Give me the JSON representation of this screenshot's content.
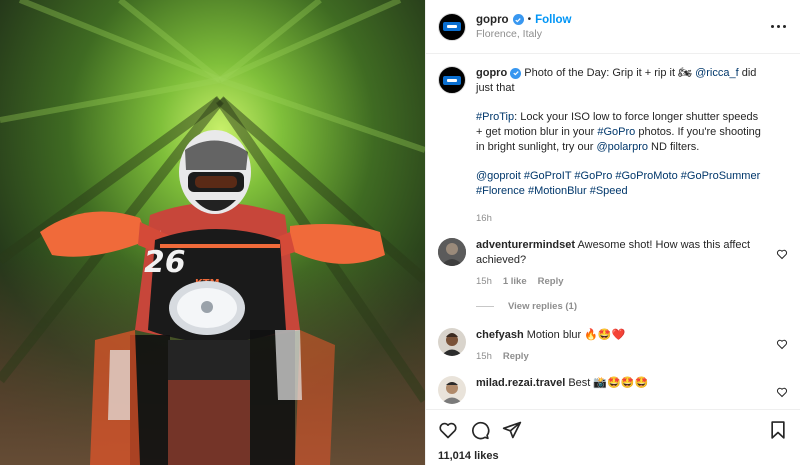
{
  "post": {
    "username": "gopro",
    "follow_label": "Follow",
    "separator": "•",
    "location": "Florence, Italy"
  },
  "caption": {
    "username": "gopro",
    "line1": "Photo of the Day: Grip it + rip it 🏍",
    "mention_ricca": "@ricca_f",
    "line1_end": " did just that",
    "protip_tag": "#ProTip",
    "protip_text_a": ": Lock your ISO low to force longer shutter speeds + get motion blur in your ",
    "gopro_tag": "#GoPro",
    "protip_text_b": " photos. If you're shooting in bright sunlight, try our ",
    "mention_polarpro": "@polarpro",
    "protip_text_c": " ND filters.",
    "hashtags": "@goproit #GoProIT #GoPro #GoProMoto #GoProSummer #Florence #MotionBlur #Speed",
    "time": "16h"
  },
  "comments": [
    {
      "username": "adventurermindset",
      "text": "Awesome shot! How was this affect achieved?",
      "time": "15h",
      "likes": "1 like",
      "reply_label": "Reply",
      "view_replies": "View replies (1)"
    },
    {
      "username": "chefyash",
      "text": "Motion blur 🔥🤩❤️",
      "time": "15h",
      "reply_label": "Reply"
    },
    {
      "username": "milad.rezai.travel",
      "text": "Best 📸🤩🤩🤩"
    }
  ],
  "footer": {
    "likes": "11,014 likes"
  },
  "icons": {
    "heart": "heart-icon",
    "comment": "comment-icon",
    "share": "share-icon",
    "bookmark": "bookmark-icon",
    "verified": "verified-icon",
    "more": "more-options-icon"
  },
  "colors": {
    "link_blue": "#0095f6",
    "tag_blue": "#00376b",
    "verified_blue": "#3897f0",
    "muted": "#8e8e8e",
    "photo_orange": "#e8562a"
  }
}
